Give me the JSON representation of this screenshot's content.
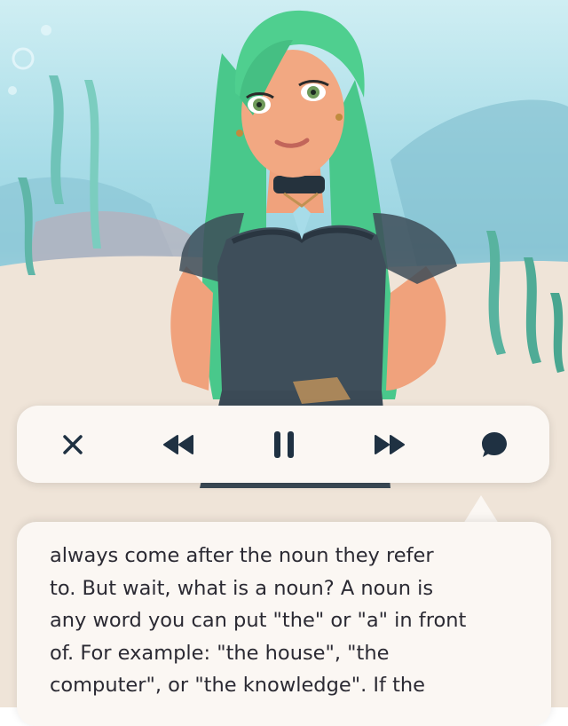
{
  "controls": {
    "close": "close-icon",
    "rewind": "rewind-icon",
    "pause": "pause-icon",
    "fast_forward": "fast-forward-icon",
    "chat": "chat-bubble-icon",
    "icon_color": "#1f3142"
  },
  "speech": {
    "lines": [
      "always come after the noun they refer",
      "to. But wait, what is a noun? A noun is",
      "any word you can put \"the\" or \"a\" in front",
      "of. For example: \"the house\", \"the",
      "computer\", or \"the knowledge\". If the"
    ]
  }
}
